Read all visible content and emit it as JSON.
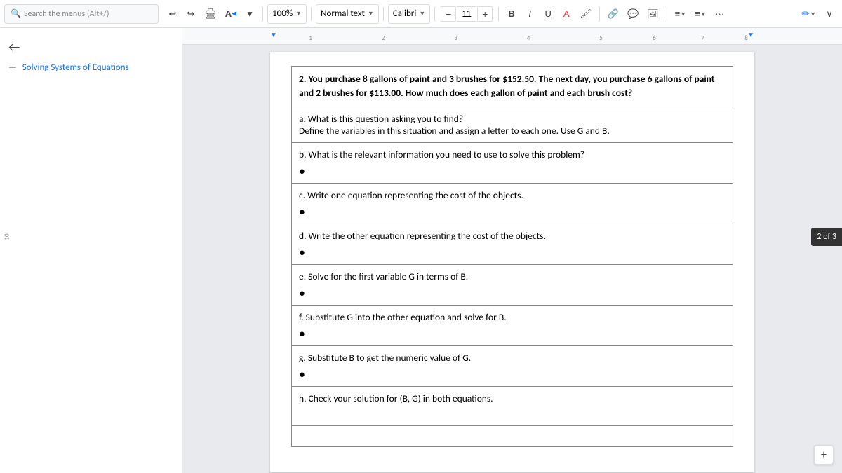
{
  "toolbar": {
    "search_placeholder": "Search the menus (Alt+/)",
    "zoom": "100%",
    "text_style": "Normal text",
    "font": "Calibri",
    "font_size": "11",
    "undo_label": "↩",
    "redo_label": "↪",
    "print_label": "🖨",
    "format_label": "A",
    "filter_label": "▼",
    "minus_label": "−",
    "plus_label": "+",
    "bold_label": "B",
    "italic_label": "I",
    "underline_label": "U",
    "strikethrough_label": "A",
    "color_label": "🖌",
    "link_label": "🔗",
    "comment_label": "💬",
    "image_label": "🖼",
    "align_label": "≡",
    "list_label": "≡",
    "more_label": "···",
    "edit_label": "✏",
    "expand_label": "∨"
  },
  "sidebar": {
    "back_icon": "←",
    "title": "Solving Systems of Equations"
  },
  "ruler": {
    "markers": [
      "1",
      "2",
      "3",
      "4",
      "5",
      "6",
      "7",
      "8"
    ]
  },
  "page": {
    "header_text": "2. You purchase 8 gallons of paint and 3 brushes for $152.50.  The next day, you purchase 6 gallons of paint and 2 brushes for $113.00.  How much does each gallon of paint and each brush cost?",
    "rows": [
      {
        "label": "a. What is this question asking you to find?",
        "sublabel": "Define the variables in this situation and assign a letter to each one. Use G and B.",
        "has_bullet": false
      },
      {
        "label": "b. What is the relevant information you need to use to solve this problem?",
        "sublabel": "",
        "has_bullet": true
      },
      {
        "label": "c. Write one equation representing the cost of the objects.",
        "sublabel": "",
        "has_bullet": true
      },
      {
        "label": "d. Write the other equation representing the cost of the objects.",
        "sublabel": "",
        "has_bullet": true
      },
      {
        "label": "e. Solve for the first variable G in terms of B.",
        "sublabel": "",
        "has_bullet": true
      },
      {
        "label": "f. Substitute G into the other equation and solve for B.",
        "sublabel": "",
        "has_bullet": true
      },
      {
        "label": "g. Substitute B to get the numeric value of G.",
        "sublabel": "",
        "has_bullet": true
      },
      {
        "label": "h. Check your solution for (B, G) in both equations.",
        "sublabel": "",
        "has_bullet": false,
        "extra_space": true
      }
    ]
  },
  "page_indicator": {
    "text": "2 of 3"
  }
}
